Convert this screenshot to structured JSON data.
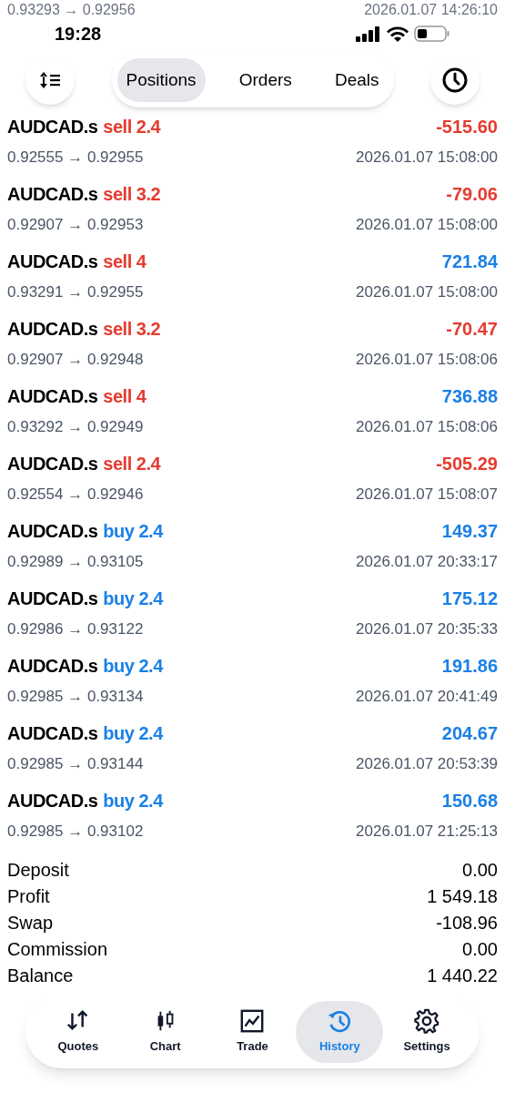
{
  "status_bar": {
    "time": "19:28"
  },
  "faded_row": {
    "prices": "0.93293 → 0.92956",
    "time": "2026.01.07 14:26:10"
  },
  "tabs": [
    {
      "label": "Positions",
      "selected": true
    },
    {
      "label": "Orders",
      "selected": false
    },
    {
      "label": "Deals",
      "selected": false
    }
  ],
  "deals": [
    {
      "symbol": "AUDCAD.s",
      "kind": "sell",
      "side": "sell 2.4",
      "profit": "-515.60",
      "profit_positive": false,
      "prices": "0.92555 → 0.92955",
      "time": "2026.01.07 15:08:00"
    },
    {
      "symbol": "AUDCAD.s",
      "kind": "sell",
      "side": "sell 3.2",
      "profit": "-79.06",
      "profit_positive": false,
      "prices": "0.92907 → 0.92953",
      "time": "2026.01.07 15:08:00"
    },
    {
      "symbol": "AUDCAD.s",
      "kind": "sell",
      "side": "sell 4",
      "profit": "721.84",
      "profit_positive": true,
      "prices": "0.93291 → 0.92955",
      "time": "2026.01.07 15:08:00"
    },
    {
      "symbol": "AUDCAD.s",
      "kind": "sell",
      "side": "sell 3.2",
      "profit": "-70.47",
      "profit_positive": false,
      "prices": "0.92907 → 0.92948",
      "time": "2026.01.07 15:08:06"
    },
    {
      "symbol": "AUDCAD.s",
      "kind": "sell",
      "side": "sell 4",
      "profit": "736.88",
      "profit_positive": true,
      "prices": "0.93292 → 0.92949",
      "time": "2026.01.07 15:08:06"
    },
    {
      "symbol": "AUDCAD.s",
      "kind": "sell",
      "side": "sell 2.4",
      "profit": "-505.29",
      "profit_positive": false,
      "prices": "0.92554 → 0.92946",
      "time": "2026.01.07 15:08:07"
    },
    {
      "symbol": "AUDCAD.s",
      "kind": "buy",
      "side": "buy 2.4",
      "profit": "149.37",
      "profit_positive": true,
      "prices": "0.92989 → 0.93105",
      "time": "2026.01.07 20:33:17"
    },
    {
      "symbol": "AUDCAD.s",
      "kind": "buy",
      "side": "buy 2.4",
      "profit": "175.12",
      "profit_positive": true,
      "prices": "0.92986 → 0.93122",
      "time": "2026.01.07 20:35:33"
    },
    {
      "symbol": "AUDCAD.s",
      "kind": "buy",
      "side": "buy 2.4",
      "profit": "191.86",
      "profit_positive": true,
      "prices": "0.92985 → 0.93134",
      "time": "2026.01.07 20:41:49"
    },
    {
      "symbol": "AUDCAD.s",
      "kind": "buy",
      "side": "buy 2.4",
      "profit": "204.67",
      "profit_positive": true,
      "prices": "0.92985 → 0.93144",
      "time": "2026.01.07 20:53:39"
    },
    {
      "symbol": "AUDCAD.s",
      "kind": "buy",
      "side": "buy 2.4",
      "profit": "150.68",
      "profit_positive": true,
      "prices": "0.92985 → 0.93102",
      "time": "2026.01.07 21:25:13"
    }
  ],
  "summary": [
    {
      "label": "Deposit",
      "value": "0.00"
    },
    {
      "label": "Profit",
      "value": "1 549.18"
    },
    {
      "label": "Swap",
      "value": "-108.96"
    },
    {
      "label": "Commission",
      "value": "0.00"
    },
    {
      "label": "Balance",
      "value": "1 440.22"
    }
  ],
  "nav": [
    {
      "label": "Quotes",
      "selected": false
    },
    {
      "label": "Chart",
      "selected": false
    },
    {
      "label": "Trade",
      "selected": false
    },
    {
      "label": "History",
      "selected": true
    },
    {
      "label": "Settings",
      "selected": false
    }
  ]
}
